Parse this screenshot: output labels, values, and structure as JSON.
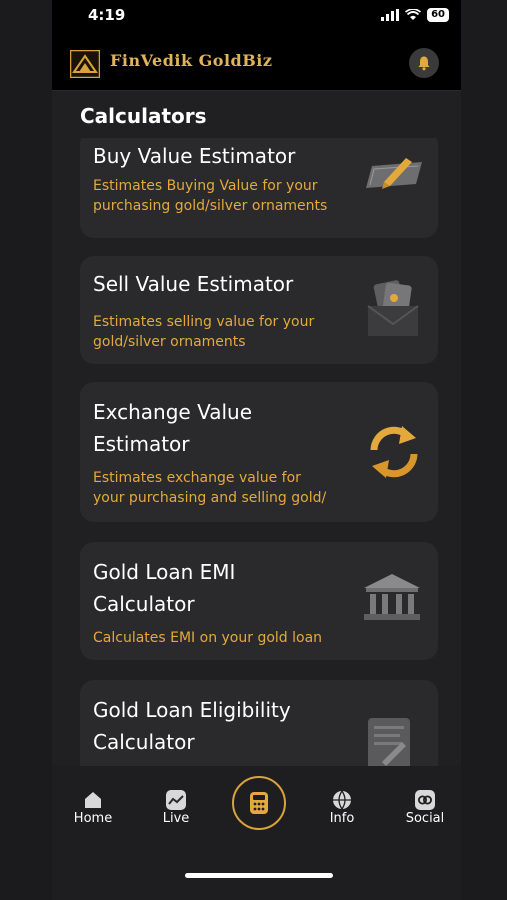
{
  "status": {
    "time": "4:19",
    "battery": "60"
  },
  "app": {
    "brand": "FinVedik GoldBiz"
  },
  "page": {
    "section_title": "Calculators"
  },
  "cards": [
    {
      "title_lines": [
        "Buy Value Estimator"
      ],
      "desc_lines": [
        "Estimates Buying Value for your",
        "purchasing gold/silver ornaments"
      ],
      "icon": "ruler-pencil-icon"
    },
    {
      "title_lines": [
        "Sell Value Estimator"
      ],
      "desc_lines": [
        "Estimates selling value for your",
        "gold/silver ornaments"
      ],
      "icon": "money-envelope-icon"
    },
    {
      "title_lines": [
        "Exchange Value",
        "Estimator"
      ],
      "desc_lines": [
        "Estimates exchange value for",
        "your purchasing and selling gold/"
      ],
      "icon": "exchange-arrows-icon"
    },
    {
      "title_lines": [
        "Gold Loan EMI",
        "Calculator"
      ],
      "desc_lines": [
        "Calculates EMI on your gold loan"
      ],
      "icon": "bank-building-icon"
    },
    {
      "title_lines": [
        "Gold Loan Eligibility",
        "Calculator"
      ],
      "desc_lines": [],
      "icon": "document-icon"
    }
  ],
  "nav": {
    "home": "Home",
    "live": "Live",
    "info": "Info",
    "social": "Social"
  },
  "colors": {
    "accent": "#e3a93d",
    "card": "#2a2a2c",
    "background": "#202022"
  }
}
